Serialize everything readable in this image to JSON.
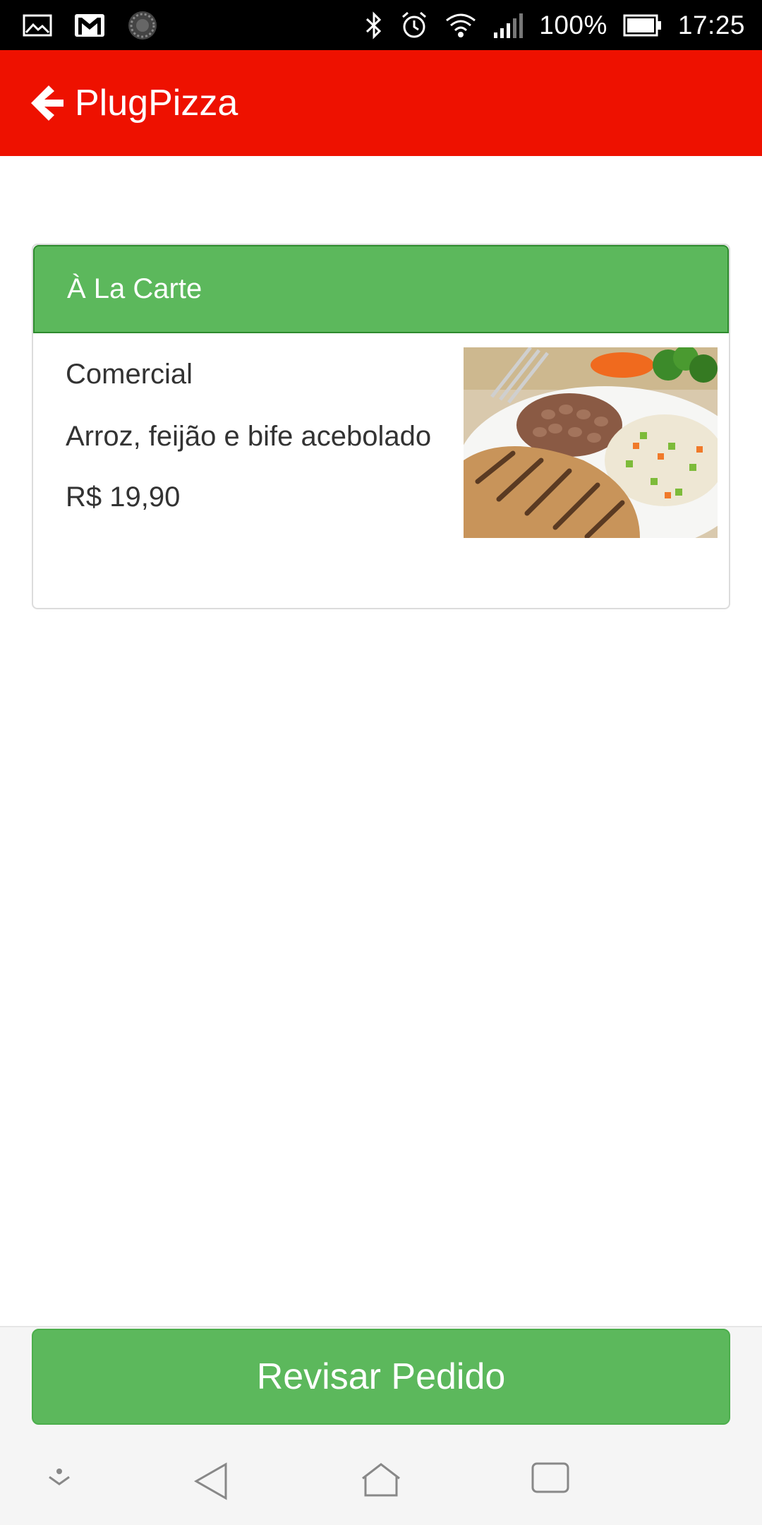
{
  "status_bar": {
    "battery_percent": "100%",
    "time": "17:25",
    "icons": [
      "gallery-icon",
      "gmail-icon",
      "sync-icon",
      "bluetooth-icon",
      "alarm-icon",
      "wifi-icon",
      "signal-icon",
      "battery-icon"
    ],
    "battery_level": 1.0
  },
  "app_bar": {
    "title": "PlugPizza",
    "back_icon": "arrow-left-icon",
    "background_color": "#ee1100"
  },
  "menu_section": {
    "header": "À La Carte",
    "header_color": "#5cb85c",
    "items": [
      {
        "name": "Comercial",
        "description": "Arroz, feijão e bife acebolado",
        "price": "R$ 19,90",
        "image": "food-photo"
      }
    ]
  },
  "footer": {
    "review_button_label": "Revisar Pedido",
    "button_color": "#5cb85c"
  },
  "nav_bar": {
    "icons": [
      "notification-down-icon",
      "back-triangle-icon",
      "home-icon",
      "recents-icon"
    ]
  }
}
